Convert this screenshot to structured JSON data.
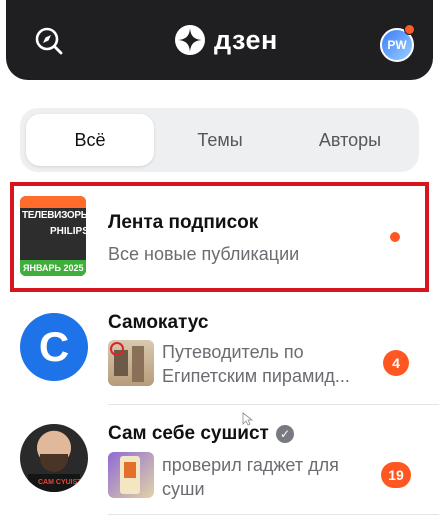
{
  "header": {
    "logo_text": "дзен",
    "avatar_initials": "PW",
    "icons": [
      "compass-icon",
      "zen-logo-icon",
      "profile-avatar"
    ]
  },
  "tabs": [
    {
      "label": "Всё",
      "active": true
    },
    {
      "label": "Темы",
      "active": false
    },
    {
      "label": "Авторы",
      "active": false
    }
  ],
  "subscriptions_feed": {
    "title": "Лента подписок",
    "subtitle": "Все новые публикации",
    "thumbnail": {
      "line1": "ТЕЛЕВИЗОРЫ",
      "line2": "PHILIPS",
      "line3": "ЯНВАРЬ 2025"
    },
    "has_new": true
  },
  "channels": [
    {
      "name": "Самокатус",
      "avatar_letter": "C",
      "preview_line1": "Путеводитель по",
      "preview_line2": "Египетским пирамид...",
      "badge": "4",
      "verified": false
    },
    {
      "name": "Сам себе сушист",
      "avatar_letter": "",
      "avatar_shirt_text": "CAM CYUIST",
      "preview_line1": "проверил гаджет для",
      "preview_line2": "суши",
      "badge": "19",
      "verified": true
    }
  ],
  "colors": {
    "header_bg": "#1f1f21",
    "accent_orange": "#ff5722",
    "highlight_red": "#d5161d",
    "channel_blue": "#1e73e8",
    "tabs_bg": "#eeeff1"
  }
}
